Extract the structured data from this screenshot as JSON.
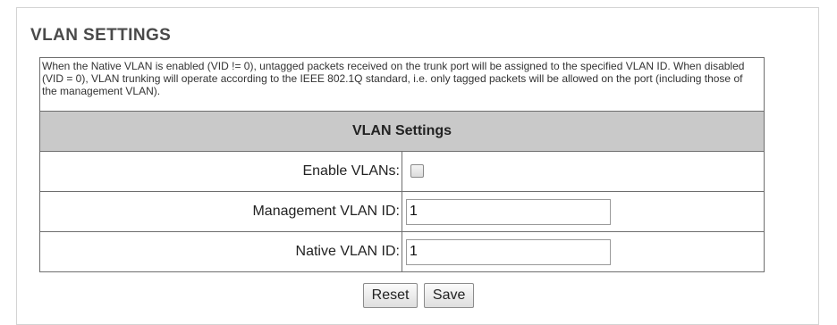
{
  "section": {
    "title": "VLAN SETTINGS",
    "description": "When the Native VLAN is enabled (VID != 0), untagged packets received on the trunk port will be assigned to the specified VLAN ID. When disabled (VID = 0), VLAN trunking will operate according to the IEEE 802.1Q standard, i.e. only tagged packets will be allowed on the port (including those of the management VLAN)."
  },
  "table": {
    "header": "VLAN Settings",
    "rows": [
      {
        "label": "Enable VLANs:",
        "type": "checkbox",
        "checked": false
      },
      {
        "label": "Management VLAN ID:",
        "type": "text",
        "value": "1"
      },
      {
        "label": "Native VLAN ID:",
        "type": "text",
        "value": "1"
      }
    ]
  },
  "buttons": {
    "reset_label": "Reset",
    "save_label": "Save"
  },
  "colors": {
    "header_bg": "#c9c9c9",
    "border": "#6e6e6e",
    "title": "#4a4a4a"
  }
}
